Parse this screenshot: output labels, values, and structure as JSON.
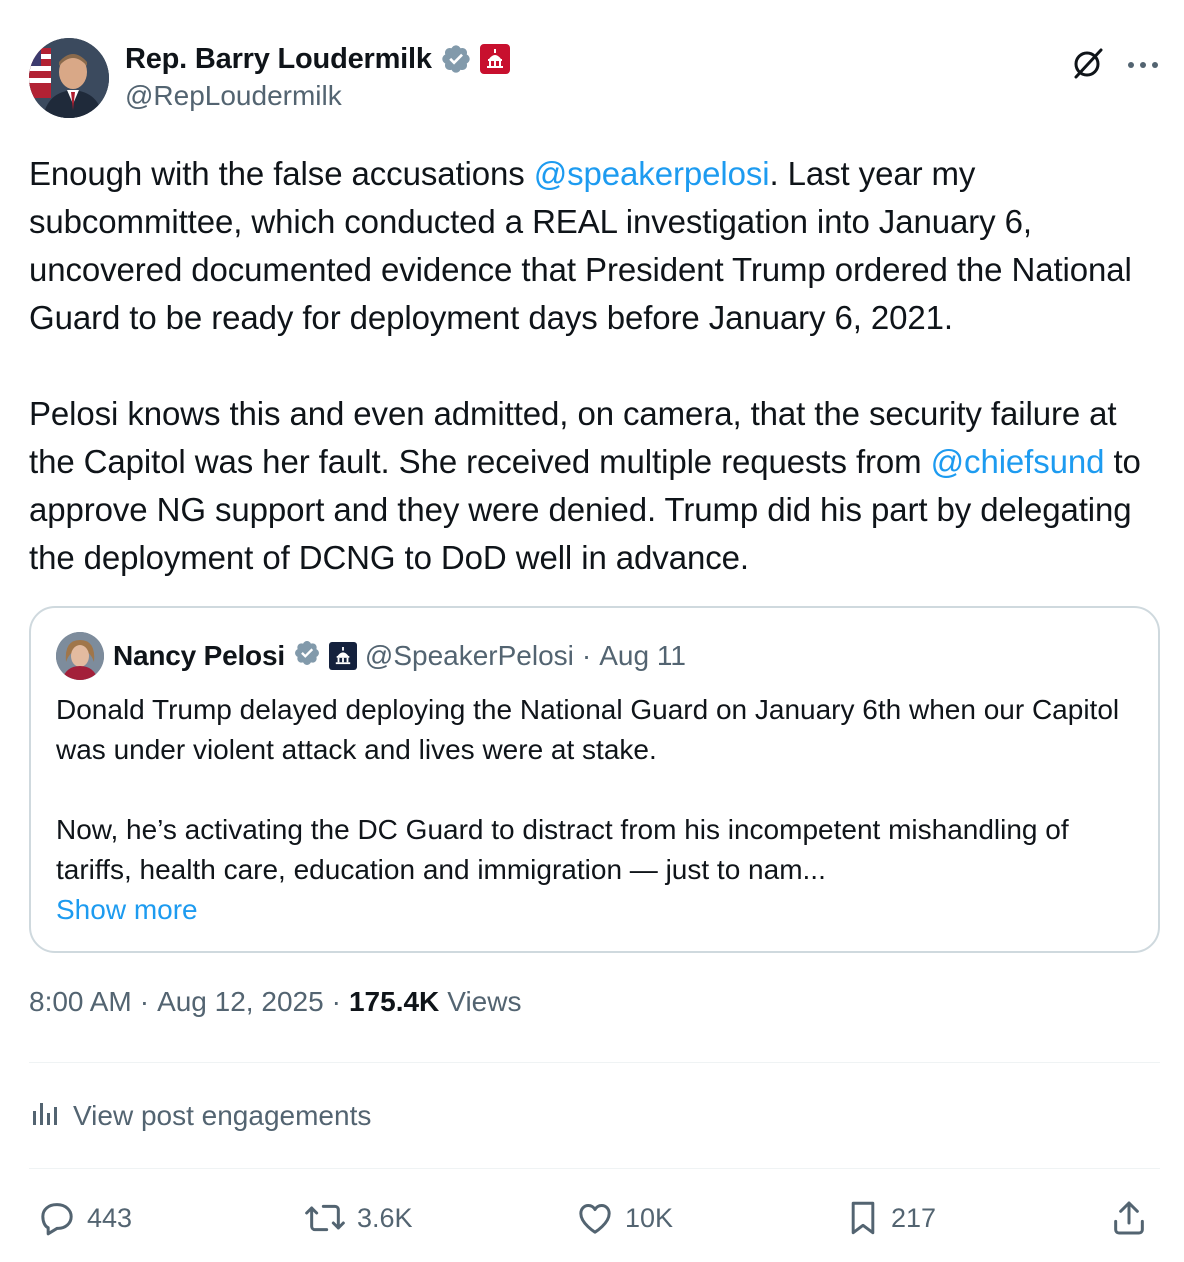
{
  "author": {
    "display_name": "Rep. Barry Loudermilk",
    "handle": "@RepLoudermilk",
    "verified_icon": "verified-badge-icon",
    "affiliation_icon": "us-capitol-badge-icon"
  },
  "tweet": {
    "p1_before": "Enough with the false accusations ",
    "p1_mention": "@speakerpelosi",
    "p1_after": ". Last year my subcommittee, which conducted a REAL investigation into January 6, uncovered documented evidence that President Trump ordered the National Guard to be ready for deployment days before January 6, 2021.",
    "p2_before": "Pelosi knows this and even admitted, on camera, that the security failure at the Capitol was her fault. She received multiple requests from ",
    "p2_mention": "@chiefsund",
    "p2_after": " to approve NG support and they were denied. Trump did his part by delegating the deployment of DCNG to DoD well in advance."
  },
  "quote": {
    "display_name": "Nancy Pelosi",
    "handle": "@SpeakerPelosi",
    "separator": "·",
    "date": "Aug 11",
    "p1": "Donald Trump delayed deploying the National Guard on January 6th when our Capitol was under violent attack and lives were at stake.",
    "p2": "Now, he’s activating the DC Guard to distract from his incompetent mishandling of tariffs, health care, education and immigration — just to nam...",
    "show_more": "Show more"
  },
  "meta": {
    "time": "8:00 AM",
    "sep1": "·",
    "date": "Aug 12, 2025",
    "sep2": "·",
    "views_count": "175.4K",
    "views_label": "Views"
  },
  "engagements_label": "View post engagements",
  "actions": {
    "replies": "443",
    "reposts": "3.6K",
    "likes": "10K",
    "bookmarks": "217"
  },
  "colors": {
    "link": "#1d9bf0",
    "secondary_text": "#536471",
    "primary_text": "#0f1419",
    "border": "#cfd9de"
  }
}
